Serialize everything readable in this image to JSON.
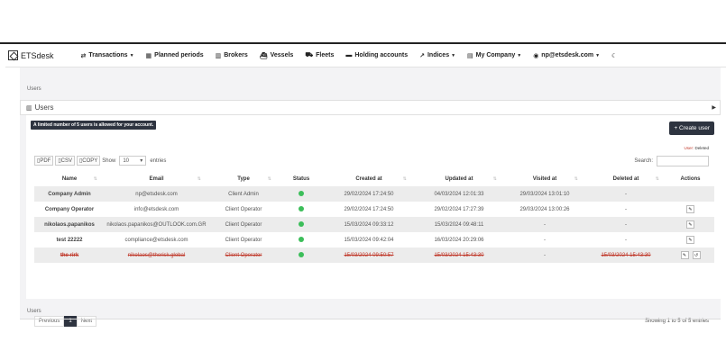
{
  "app": {
    "brand": "ETSdesk"
  },
  "nav": [
    {
      "icon": "transactions-icon",
      "glyph": "⇄",
      "label": "Transactions",
      "caret": true
    },
    {
      "icon": "calendar-icon",
      "glyph": "▦",
      "label": "Planned periods",
      "caret": false
    },
    {
      "icon": "building-icon",
      "glyph": "▥",
      "label": "Brokers",
      "caret": false
    },
    {
      "icon": "ship-icon",
      "glyph": "⛴",
      "label": "Vessels",
      "caret": false
    },
    {
      "icon": "truck-icon",
      "glyph": "⛟",
      "label": "Fleets",
      "caret": false
    },
    {
      "icon": "folder-icon",
      "glyph": "▬",
      "label": "Holding accounts",
      "caret": false
    },
    {
      "icon": "chart-icon",
      "glyph": "↗",
      "label": "Indices",
      "caret": true
    },
    {
      "icon": "company-icon",
      "glyph": "▤",
      "label": "My Company",
      "caret": true
    },
    {
      "icon": "user-icon",
      "glyph": "◉",
      "label": "np@etsdesk.com",
      "caret": true
    },
    {
      "icon": "moon-icon",
      "glyph": "☾",
      "label": "",
      "caret": false
    }
  ],
  "breadcrumb": "Users",
  "panel_title": "Users",
  "limit_notice": "A limited number of 5 users is allowed for your account.",
  "create_button": "+ Create user",
  "legend": {
    "tag": "User:",
    "value": "Deleted"
  },
  "tools": {
    "pdf": "PDF",
    "csv": "CSV",
    "copy": "COPY",
    "show": "Show",
    "show_value": "10",
    "entries": "entries"
  },
  "search_label": "Search:",
  "columns": [
    "Name",
    "Email",
    "Type",
    "Status",
    "Created at",
    "Updated at",
    "Visited at",
    "Deleted at",
    "Actions"
  ],
  "rows": [
    {
      "name": "Company Admin",
      "email": "np@etsdesk.com",
      "type": "Client Admin",
      "created": "29/02/2024 17:24:50",
      "updated": "04/03/2024 12:01:33",
      "visited": "29/03/2024 13:01:10",
      "deleted": "-",
      "actions": [],
      "deleted_row": false
    },
    {
      "name": "Company Operator",
      "email": "info@etsdesk.com",
      "type": "Client Operator",
      "created": "29/02/2024 17:24:50",
      "updated": "29/02/2024 17:27:39",
      "visited": "29/03/2024 13:00:26",
      "deleted": "-",
      "actions": [
        "edit"
      ],
      "deleted_row": false
    },
    {
      "name": "nikolaos.papanikos",
      "email": "nikolaos.papanikos@OUTLOOK.com.GR",
      "type": "Client Operator",
      "created": "15/03/2024 09:33:12",
      "updated": "15/03/2024 09:48:11",
      "visited": "-",
      "deleted": "-",
      "actions": [
        "edit"
      ],
      "deleted_row": false
    },
    {
      "name": "test 22222",
      "email": "compliance@etsdesk.com",
      "type": "Client Operator",
      "created": "15/03/2024 09:42:04",
      "updated": "16/03/2024 20:29:06",
      "visited": "-",
      "deleted": "-",
      "actions": [
        "edit"
      ],
      "deleted_row": false
    },
    {
      "name": "the rirk",
      "email": "nikolaos@therisk.global",
      "type": "Client Operator",
      "created": "15/03/2024 09:50:57",
      "updated": "15/03/2024 15:43:30",
      "visited": "-",
      "deleted": "15/03/2024 15:43:30",
      "actions": [
        "edit",
        "restore"
      ],
      "deleted_row": true
    }
  ],
  "pager": {
    "prev": "Previous",
    "page": "1",
    "next": "Next"
  },
  "info": "Showing 1 to 5 of 5 entries",
  "footer_breadcrumb": "Users"
}
